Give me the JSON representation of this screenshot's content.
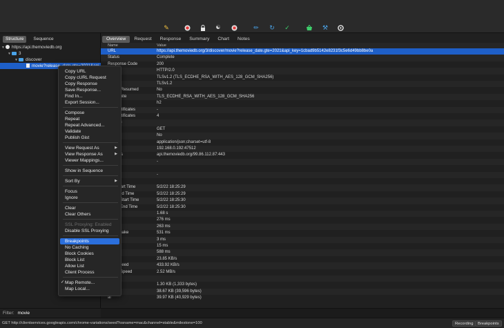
{
  "toolbar": {
    "icons": [
      "broom-icon",
      "record-icon",
      "lock-icon",
      "turtle-icon",
      "stop-icon",
      "pen-icon",
      "refresh-icon",
      "check-icon",
      "basket-icon",
      "tools-icon",
      "settings-icon"
    ]
  },
  "left": {
    "seg_structure": "Structure",
    "seg_sequence": "Sequence",
    "tree": {
      "host": "https://api.themoviedb.org",
      "n3": "3",
      "discover": "discover",
      "movie": "movie?release_date.gte=2021&api"
    }
  },
  "tabs": [
    "Overview",
    "Request",
    "Response",
    "Summary",
    "Chart",
    "Notes"
  ],
  "table": {
    "col_name": "Name",
    "col_value": "Value",
    "rows": [
      {
        "k": "URL",
        "v": "https://api.themoviedb.org/3/discover/movie?release_date.gte=2021&api_key=1cbad9b5142e8231f3c5e6d49bb8be0a"
      },
      {
        "k": "Status",
        "v": "Complete"
      },
      {
        "k": "Response Code",
        "v": "200"
      },
      {
        "k": "ocol",
        "v": "HTTP/2.0"
      },
      {
        "k": "",
        "v": "TLSv1.2 (TLS_ECDHE_RSA_WITH_AES_128_GCM_SHA256)"
      },
      {
        "k": "otocol",
        "v": "TLSv1.2"
      },
      {
        "k": "ession Resumed",
        "v": "No"
      },
      {
        "k": "pher Suite",
        "v": "TLS_ECDHE_RSA_WITH_AES_128_GCM_SHA256"
      },
      {
        "k": "N",
        "v": "h2"
      },
      {
        "k": "ent Certificates",
        "v": "-"
      },
      {
        "k": "ver Certificates",
        "v": "4"
      },
      {
        "k": "ensions",
        "v": ""
      },
      {
        "k": "",
        "v": "GET"
      },
      {
        "k": "ive",
        "v": "No"
      },
      {
        "k": "t-Type",
        "v": "application/json;charset=utf-8"
      },
      {
        "k": "ddress",
        "v": "192.168.0.192:47512"
      },
      {
        "k": "Address",
        "v": "api.themoviedb.org/99.86.112.87:443"
      },
      {
        "k": "",
        "v": "-"
      },
      {
        "k": "tion",
        "v": ""
      },
      {
        "k": "ckets",
        "v": "-"
      },
      {
        "k": "",
        "v": ""
      },
      {
        "k": "uest Start Time",
        "v": "5/2/22 18:25:29"
      },
      {
        "k": "uest End Time",
        "v": "5/2/22 18:25:29"
      },
      {
        "k": "ponse Start Time",
        "v": "5/2/22 18:25:30"
      },
      {
        "k": "ponse End Time",
        "v": "5/2/22 18:25:30"
      },
      {
        "k": "ation",
        "v": "1.68 s"
      },
      {
        "k": "",
        "v": "276 ms"
      },
      {
        "k": "nect",
        "v": "263 ms"
      },
      {
        "k": "Handshake",
        "v": "531 ms"
      },
      {
        "k": "uest",
        "v": "3 ms"
      },
      {
        "k": "ponse",
        "v": "15 ms"
      },
      {
        "k": "ncy",
        "v": "588 ms"
      },
      {
        "k": "ed",
        "v": "23.85 KB/s"
      },
      {
        "k": "uest Speed",
        "v": "433.92 KB/s"
      },
      {
        "k": "ponse Speed",
        "v": "2.52 MB/s"
      },
      {
        "k": "",
        "v": ""
      },
      {
        "k": "uest",
        "v": "1.30 KB (1,333 bytes)"
      },
      {
        "k": "ponse",
        "v": "38.67 KB (39,596 bytes)"
      },
      {
        "k": "al",
        "v": "39.97 KB (40,929 bytes)"
      }
    ]
  },
  "menu": {
    "copy_url": "Copy URL",
    "copy_curl": "Copy cURL Request",
    "copy_response": "Copy Response",
    "save_response": "Save Response...",
    "find_in": "Find In...",
    "export_session": "Export Session...",
    "compose": "Compose",
    "repeat": "Repeat",
    "repeat_advanced": "Repeat Advanced...",
    "validate": "Validate",
    "publish_gist": "Publish Gist",
    "view_request_as": "View Request As",
    "view_response_as": "View Response As",
    "viewer_mappings": "Viewer Mappings...",
    "show_in_sequence": "Show in Sequence",
    "sort_by": "Sort By",
    "focus": "Focus",
    "ignore": "Ignore",
    "clear": "Clear",
    "clear_others": "Clear Others",
    "ssl_enabled": "SSL Proxying: Enabled",
    "disable_ssl": "Disable SSL Proxying",
    "breakpoints": "Breakpoints",
    "no_caching": "No Caching",
    "block_cookies": "Block Cookies",
    "block_list": "Block List",
    "allow_list": "Allow List",
    "client_process": "Client Process",
    "map_remote": "Map Remote...",
    "map_local": "Map Local...",
    "checkmark": "✓"
  },
  "filter": {
    "label": "Filter:",
    "value": "movie"
  },
  "status": {
    "url": "GET http://clientservices.googleapis.com/chrome-variations/seed?osname=mac&channel=stable&milestone=100",
    "recording": "Recording",
    "breakpoints": "Breakpoints"
  },
  "colors": {
    "selection": "#1e5fc8",
    "menu_highlight": "#2b6fdc",
    "folder": "#4aa3e8"
  }
}
